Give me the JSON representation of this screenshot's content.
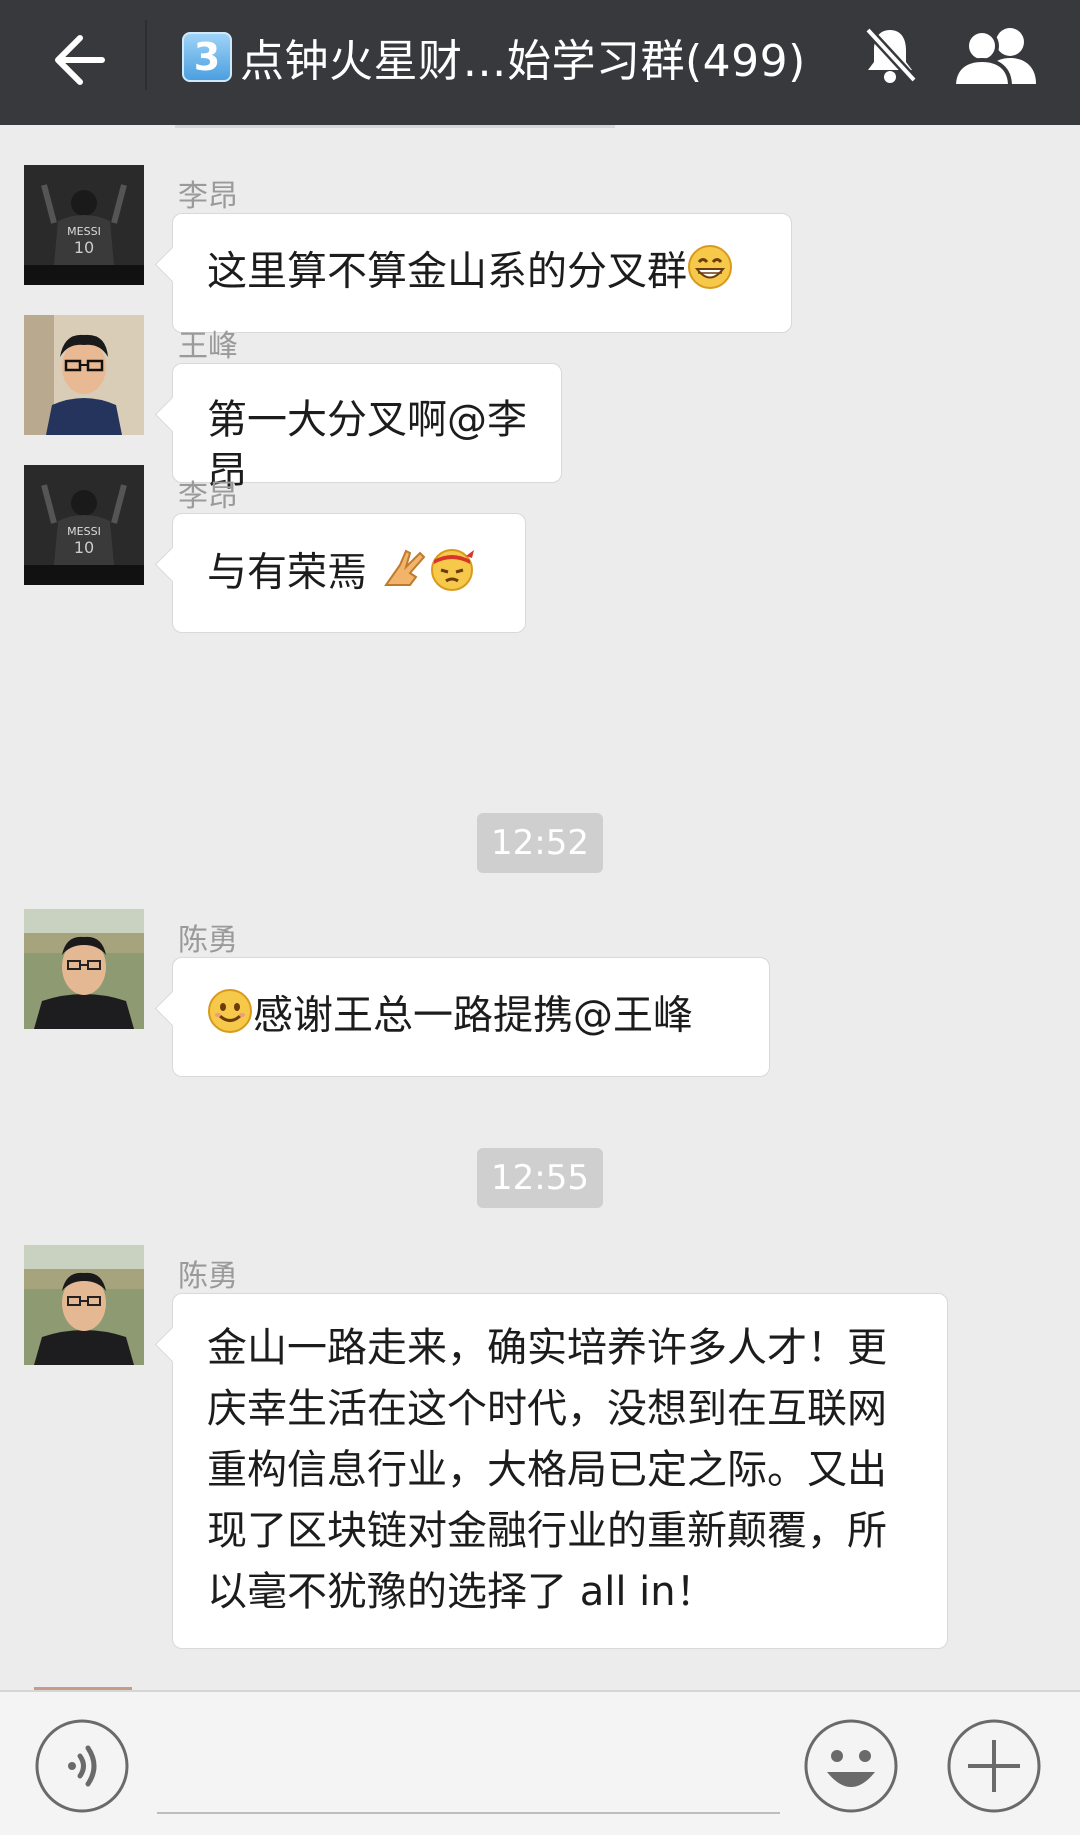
{
  "header": {
    "badge": "3",
    "title": "点钟火星财…始学习群(499)",
    "icons": {
      "back": "arrow-left-icon",
      "mute": "bell-muted-icon",
      "members": "group-members-icon"
    }
  },
  "messages": [
    {
      "sender": "李昂",
      "text": "这里算不算金山系的分叉群",
      "emoji_after": [
        "grin-emoji"
      ]
    },
    {
      "sender": "王峰",
      "text": "第一大分叉啊@李昂",
      "emoji_after": []
    },
    {
      "sender": "李昂",
      "text": "与有荣焉 ",
      "emoji_after": [
        "victory-hand-emoji",
        "angry-headband-emoji"
      ]
    },
    {
      "sender": "陈勇",
      "text": "感谢王总一路提携@王峰",
      "emoji_before": [
        "smile-emoji"
      ]
    },
    {
      "sender": "陈勇",
      "text": "金山一路走来，确实培养许多人才！更庆幸生活在这个时代，没想到在互联网重构信息行业，大格局已定之际。又出现了区块链对金融行业的重新颠覆，所以毫不犹豫的选择了 all in！"
    }
  ],
  "timestamps": [
    "12:52",
    "12:55"
  ],
  "bottom_bar": {
    "icons": {
      "voice": "voice-input-icon",
      "emoji": "emoji-icon",
      "more": "plus-icon"
    }
  },
  "colors": {
    "header_bg": "#37393d",
    "chat_bg": "#ececec",
    "bubble_bg": "#ffffff",
    "time_pill": "#cfcfcf"
  }
}
